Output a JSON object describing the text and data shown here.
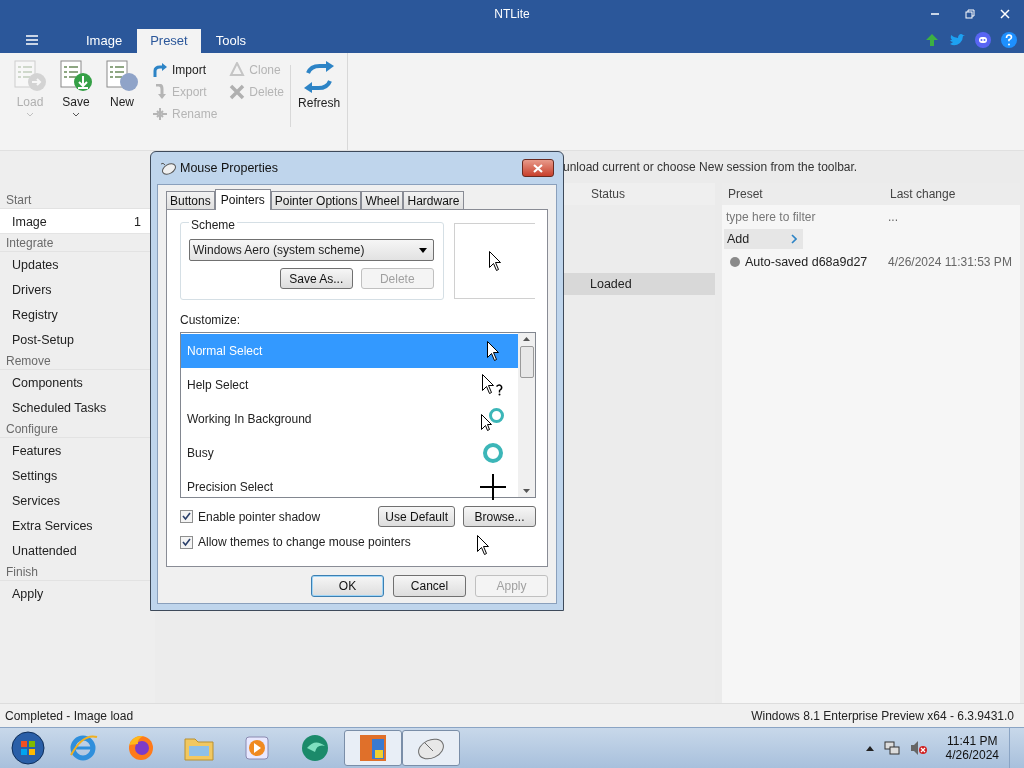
{
  "window": {
    "title": "NTLite"
  },
  "tabs": [
    {
      "label": "Image",
      "selected": false
    },
    {
      "label": "Preset",
      "selected": true
    },
    {
      "label": "Tools",
      "selected": false
    }
  ],
  "ribbon": {
    "large_buttons": [
      {
        "label": "Load",
        "kind": "load",
        "disabled": true,
        "dropdown": true
      },
      {
        "label": "Save",
        "kind": "save",
        "disabled": false,
        "dropdown": true
      },
      {
        "label": "New",
        "kind": "new",
        "disabled": false,
        "dropdown": false
      }
    ],
    "small_columns": [
      [
        {
          "label": "Import",
          "kind": "import",
          "disabled": false
        },
        {
          "label": "Export",
          "kind": "export",
          "disabled": true
        },
        {
          "label": "Rename",
          "kind": "rename",
          "disabled": true
        }
      ],
      [
        {
          "label": "Clone",
          "kind": "clone",
          "disabled": true
        },
        {
          "label": "Delete",
          "kind": "delete",
          "disabled": true
        }
      ]
    ],
    "refresh": {
      "label": "Refresh"
    }
  },
  "sidebar": {
    "sections": [
      {
        "title": "Start",
        "items": [
          {
            "label": "Image",
            "count": "1",
            "selected": true
          }
        ]
      },
      {
        "title": "Integrate",
        "items": [
          {
            "label": "Updates",
            "selected": false
          },
          {
            "label": "Drivers",
            "selected": false
          },
          {
            "label": "Registry",
            "selected": false
          },
          {
            "label": "Post-Setup",
            "selected": false
          }
        ]
      },
      {
        "title": "Remove",
        "items": [
          {
            "label": "Components",
            "selected": false
          },
          {
            "label": "Scheduled Tasks",
            "selected": false
          }
        ]
      },
      {
        "title": "Configure",
        "items": [
          {
            "label": "Features",
            "selected": false
          },
          {
            "label": "Settings",
            "selected": false
          },
          {
            "label": "Services",
            "selected": false
          },
          {
            "label": "Extra Services",
            "selected": false
          },
          {
            "label": "Unattended",
            "selected": false
          }
        ]
      },
      {
        "title": "Finish",
        "items": [
          {
            "label": "Apply",
            "selected": false
          }
        ]
      }
    ]
  },
  "message": "unload current or choose New session from the toolbar.",
  "image_table": {
    "columns": [
      "Status"
    ],
    "rows": [
      {
        "status": "Loaded",
        "selected": true
      }
    ]
  },
  "presets": {
    "columns": [
      "Preset",
      "Last change"
    ],
    "filter_placeholder": "type here to filter",
    "filter_date": "...",
    "add_label": "Add",
    "items": [
      {
        "name": "Auto-saved d68a9d27",
        "date": "4/26/2024 11:31:53 PM"
      }
    ]
  },
  "dialog": {
    "title": "Mouse Properties",
    "tabs": [
      {
        "label": "Buttons",
        "selected": false
      },
      {
        "label": "Pointers",
        "selected": true
      },
      {
        "label": "Pointer Options",
        "selected": false
      },
      {
        "label": "Wheel",
        "selected": false
      },
      {
        "label": "Hardware",
        "selected": false
      }
    ],
    "scheme_label": "Scheme",
    "scheme_value": "Windows Aero (system scheme)",
    "scheme_buttons": [
      {
        "label": "Save As...",
        "disabled": false
      },
      {
        "label": "Delete",
        "disabled": true
      }
    ],
    "customize_label": "Customize:",
    "pointers": [
      {
        "name": "Normal Select",
        "kind": "arrow",
        "selected": true
      },
      {
        "name": "Help Select",
        "kind": "help",
        "selected": false
      },
      {
        "name": "Working In Background",
        "kind": "working",
        "selected": false
      },
      {
        "name": "Busy",
        "kind": "busy",
        "selected": false
      },
      {
        "name": "Precision Select",
        "kind": "cross",
        "selected": false
      }
    ],
    "checkboxes": [
      {
        "label": "Enable pointer shadow",
        "checked": true
      },
      {
        "label": "Allow themes to change mouse pointers",
        "checked": true
      }
    ],
    "pointer_buttons": [
      {
        "label": "Use Default",
        "disabled": false
      },
      {
        "label": "Browse...",
        "disabled": false
      }
    ],
    "buttons": [
      {
        "label": "OK",
        "disabled": false,
        "default": true
      },
      {
        "label": "Cancel",
        "disabled": false,
        "default": false
      },
      {
        "label": "Apply",
        "disabled": true,
        "default": false
      }
    ]
  },
  "status_bar": {
    "left": "Completed - Image load",
    "right": "Windows 8.1 Enterprise Preview x64 - 6.3.9431.0"
  },
  "taskbar": {
    "apps": [
      {
        "kind": "ie",
        "active": false
      },
      {
        "kind": "firefox",
        "active": false
      },
      {
        "kind": "explorer",
        "active": false
      },
      {
        "kind": "media",
        "active": false
      },
      {
        "kind": "green",
        "active": false
      },
      {
        "kind": "ntlite",
        "active": true
      },
      {
        "kind": "mouse",
        "active": true
      }
    ],
    "time": "11:41 PM",
    "date": "4/26/2024"
  }
}
